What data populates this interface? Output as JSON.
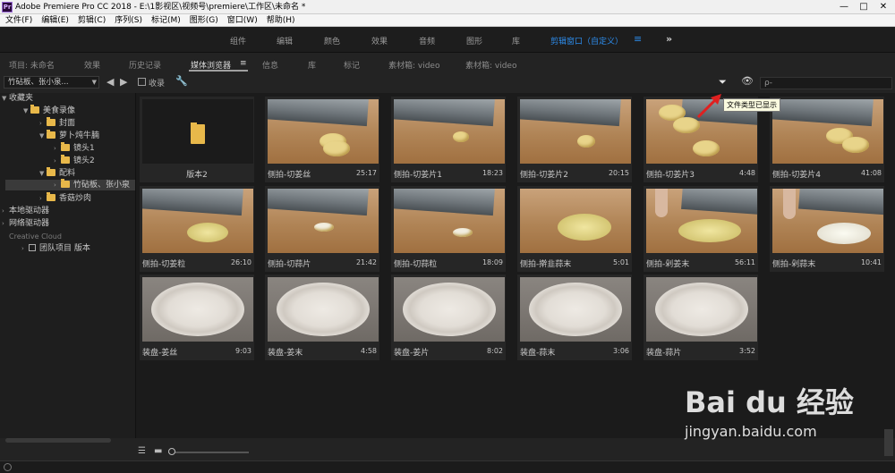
{
  "window": {
    "title": "Adobe Premiere Pro CC 2018 - E:\\1影视区\\视频号\\premiere\\工作区\\未命名 *",
    "logo_text": "Pr",
    "controls": [
      "—",
      "□",
      "✕"
    ]
  },
  "menu": [
    "文件(F)",
    "编辑(E)",
    "剪辑(C)",
    "序列(S)",
    "标记(M)",
    "图形(G)",
    "窗口(W)",
    "帮助(H)"
  ],
  "workspaces": {
    "items": [
      "组件",
      "编辑",
      "颜色",
      "效果",
      "音频",
      "图形",
      "库"
    ],
    "active": "剪辑窗口（自定义）",
    "active_menu_glyph": "≡",
    "more": "»"
  },
  "panel_tabs": {
    "project": "项目: 未命名",
    "effects": "效果",
    "history": "历史记录",
    "media_browser": "媒体浏览器",
    "media_browser_menu": "≡",
    "info": "信息",
    "library": "库",
    "markers": "标记",
    "bin1": "素材箱: video",
    "bin2": "素材箱: video"
  },
  "left": {
    "location_dropdown": "竹砧板、张小泉...",
    "back_arrow": "◀",
    "forward_arrow": "▶",
    "tree": {
      "favorites": "收藏夹",
      "meishi": "美食录像",
      "fengmian": "封面",
      "luobo": "萝卜炖牛腩",
      "jingtou1": "镜头1",
      "jingtou2": "镜头2",
      "peiliao": "配料",
      "zhuzhan": "竹砧板、张小泉",
      "xianggu": "香菇炒肉",
      "local": "本地驱动器",
      "network": "网络驱动器",
      "cloud_header": "Creative Cloud",
      "team": "团队项目 版本"
    }
  },
  "toolbar": {
    "collect_label": "收录",
    "wrench_icon": "🔧",
    "filter_icon": "⏷",
    "eye_icon": "👁",
    "search_placeholder": "ρ-",
    "tooltip": "文件类型已显示"
  },
  "cards": [
    {
      "name": "版本2",
      "duration": "",
      "kind": "folder"
    },
    {
      "name": "侧拍-切姜丝",
      "duration": "25:17",
      "kind": "ginger-slices"
    },
    {
      "name": "侧拍-切姜片1",
      "duration": "18:23",
      "kind": "ginger-one"
    },
    {
      "name": "侧拍-切姜片2",
      "duration": "20:15",
      "kind": "ginger-one"
    },
    {
      "name": "侧拍-切姜片3",
      "duration": "4:48",
      "kind": "ginger-many"
    },
    {
      "name": "侧拍-切姜片4",
      "duration": "41:08",
      "kind": "ginger-many"
    },
    {
      "name": "侧拍-切姜粒",
      "duration": "26:10",
      "kind": "mince"
    },
    {
      "name": "侧拍-切蒜片",
      "duration": "21:42",
      "kind": "garlic"
    },
    {
      "name": "侧拍-切蒜粒",
      "duration": "18:09",
      "kind": "garlic"
    },
    {
      "name": "侧拍-擀韭蒜末",
      "duration": "5:01",
      "kind": "mince"
    },
    {
      "name": "侧拍-剁姜末",
      "duration": "56:11",
      "kind": "mince-hand"
    },
    {
      "name": "侧拍-剁蒜末",
      "duration": "10:41",
      "kind": "mince-hand"
    },
    {
      "name": "装盘-姜丝",
      "duration": "9:03",
      "kind": "plate"
    },
    {
      "name": "装盘-姜末",
      "duration": "4:58",
      "kind": "plate"
    },
    {
      "name": "装盘-姜片",
      "duration": "8:02",
      "kind": "plate"
    },
    {
      "name": "装盘-蒜末",
      "duration": "3:06",
      "kind": "plate"
    },
    {
      "name": "装盘-蒜片",
      "duration": "3:52",
      "kind": "plate"
    }
  ],
  "bottom": {
    "list_view_icon": "☰",
    "icon_view_icon": "▬"
  },
  "watermark": {
    "brand": "Bai du 经验",
    "url": "jingyan.baidu.com"
  }
}
